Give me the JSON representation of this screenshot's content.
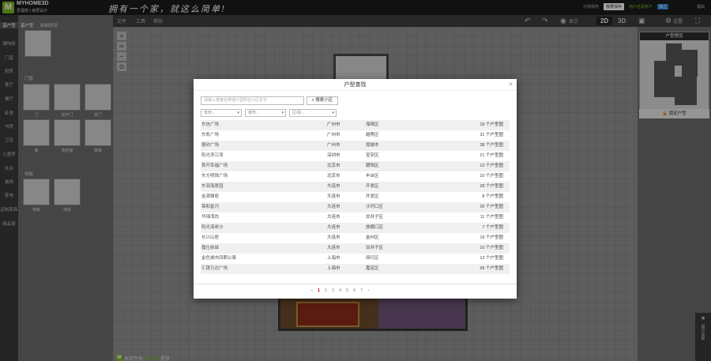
{
  "header": {
    "brand": "MYHOME3D",
    "brand_sub": "爱福窝 | 家居设计",
    "slogan": "拥有一个家，就这么简单!",
    "save_hint": "记得保存",
    "save_button": "我要保存",
    "account": "用户名是账户",
    "badge": "独立",
    "logout": "退出"
  },
  "toolbar": {
    "menus": [
      "文件",
      "工具",
      "帮助"
    ],
    "display_label": "显示",
    "view_2d": "2D",
    "view_3d": "3D",
    "settings_label": "设置"
  },
  "categories": [
    "基户型",
    "铺地砖",
    "门窗",
    "厨房",
    "客厅",
    "餐厅",
    "卧室",
    "书房",
    "卫浴",
    "儿童房",
    "玄关",
    "装饰",
    "家电",
    "定制家具",
    "精品套"
  ],
  "catalog": {
    "tabs": [
      "基户型",
      "绘制房间"
    ],
    "section_doors": "门窗",
    "doors": [
      "门",
      "双开门",
      "拱门",
      "窗",
      "落地窗",
      "飘窗"
    ],
    "section_floor": "地板",
    "floors": [
      "地板",
      "地毯"
    ]
  },
  "right_panel": {
    "minimap_title": "户型预览",
    "lock_layout": "锁定户型",
    "vertical_button": "显示全部"
  },
  "statusbar": {
    "prefix": "本软件由",
    "highlight": "爱福窝",
    "suffix": "提供"
  },
  "modal": {
    "title": "户型查找",
    "search_placeholder": "请输入楼盘名称或户型所在小区名字",
    "search_button": "搜索小区",
    "province_select": "省份...",
    "city_select": "城市...",
    "district_select": "区/县...",
    "rows": [
      {
        "name": "东信广场",
        "city": "广州市",
        "district": "海珠区",
        "count": "18 个户型图"
      },
      {
        "name": "东凯广场",
        "city": "广州市",
        "district": "越秀区",
        "count": "31 个户型图"
      },
      {
        "name": "顺欣广场",
        "city": "广州市",
        "district": "增城市",
        "count": "38 个户型图"
      },
      {
        "name": "阳光滨江湾",
        "city": "深圳市",
        "district": "宝安区",
        "count": "21 个户型图"
      },
      {
        "name": "首开幸福广场",
        "city": "北京市",
        "district": "朝阳区",
        "count": "13 个户型图"
      },
      {
        "name": "东方明珠广场",
        "city": "北京市",
        "district": "丰台区",
        "count": "10 个户型图"
      },
      {
        "name": "东润海景园",
        "city": "大连市",
        "district": "开发区",
        "count": "28 个户型图"
      },
      {
        "name": "金源雅居",
        "city": "大连市",
        "district": "开发区",
        "count": "8 个户型图"
      },
      {
        "name": "锦和星河",
        "city": "大连市",
        "district": "沙河口区",
        "count": "26 个户型图"
      },
      {
        "name": "华锦湾尚",
        "city": "大连市",
        "district": "甘井子区",
        "count": "11 个户型图"
      },
      {
        "name": "阳光海岸沙",
        "city": "大连市",
        "district": "旅顺口区",
        "count": "7 个户型图"
      },
      {
        "name": "长兴山居",
        "city": "大连市",
        "district": "金州区",
        "count": "19 个户型图"
      },
      {
        "name": "嘉仕新城",
        "city": "大连市",
        "district": "甘井子区",
        "count": "10 个户型图"
      },
      {
        "name": "金色城市四期公寓",
        "city": "上海市",
        "district": "闵行区",
        "count": "13 个户型图"
      },
      {
        "name": "汇银万达广场",
        "city": "上海市",
        "district": "嘉定区",
        "count": "99 个户型图"
      }
    ],
    "pager": {
      "prev": "‹",
      "pages": [
        "1",
        "2",
        "3",
        "4",
        "5",
        "6",
        "7"
      ],
      "current": "1",
      "next": "›"
    }
  },
  "icons": {
    "undo": "undo-icon",
    "redo": "redo-icon",
    "eye": "eye-icon",
    "camera": "camera-icon",
    "gear": "gear-icon",
    "fullscreen": "fullscreen-icon",
    "lock": "lock-icon",
    "search": "search-icon",
    "close": "close-icon"
  },
  "colors": {
    "brand_green": "#7ab229",
    "page_current": "#cc0000"
  }
}
